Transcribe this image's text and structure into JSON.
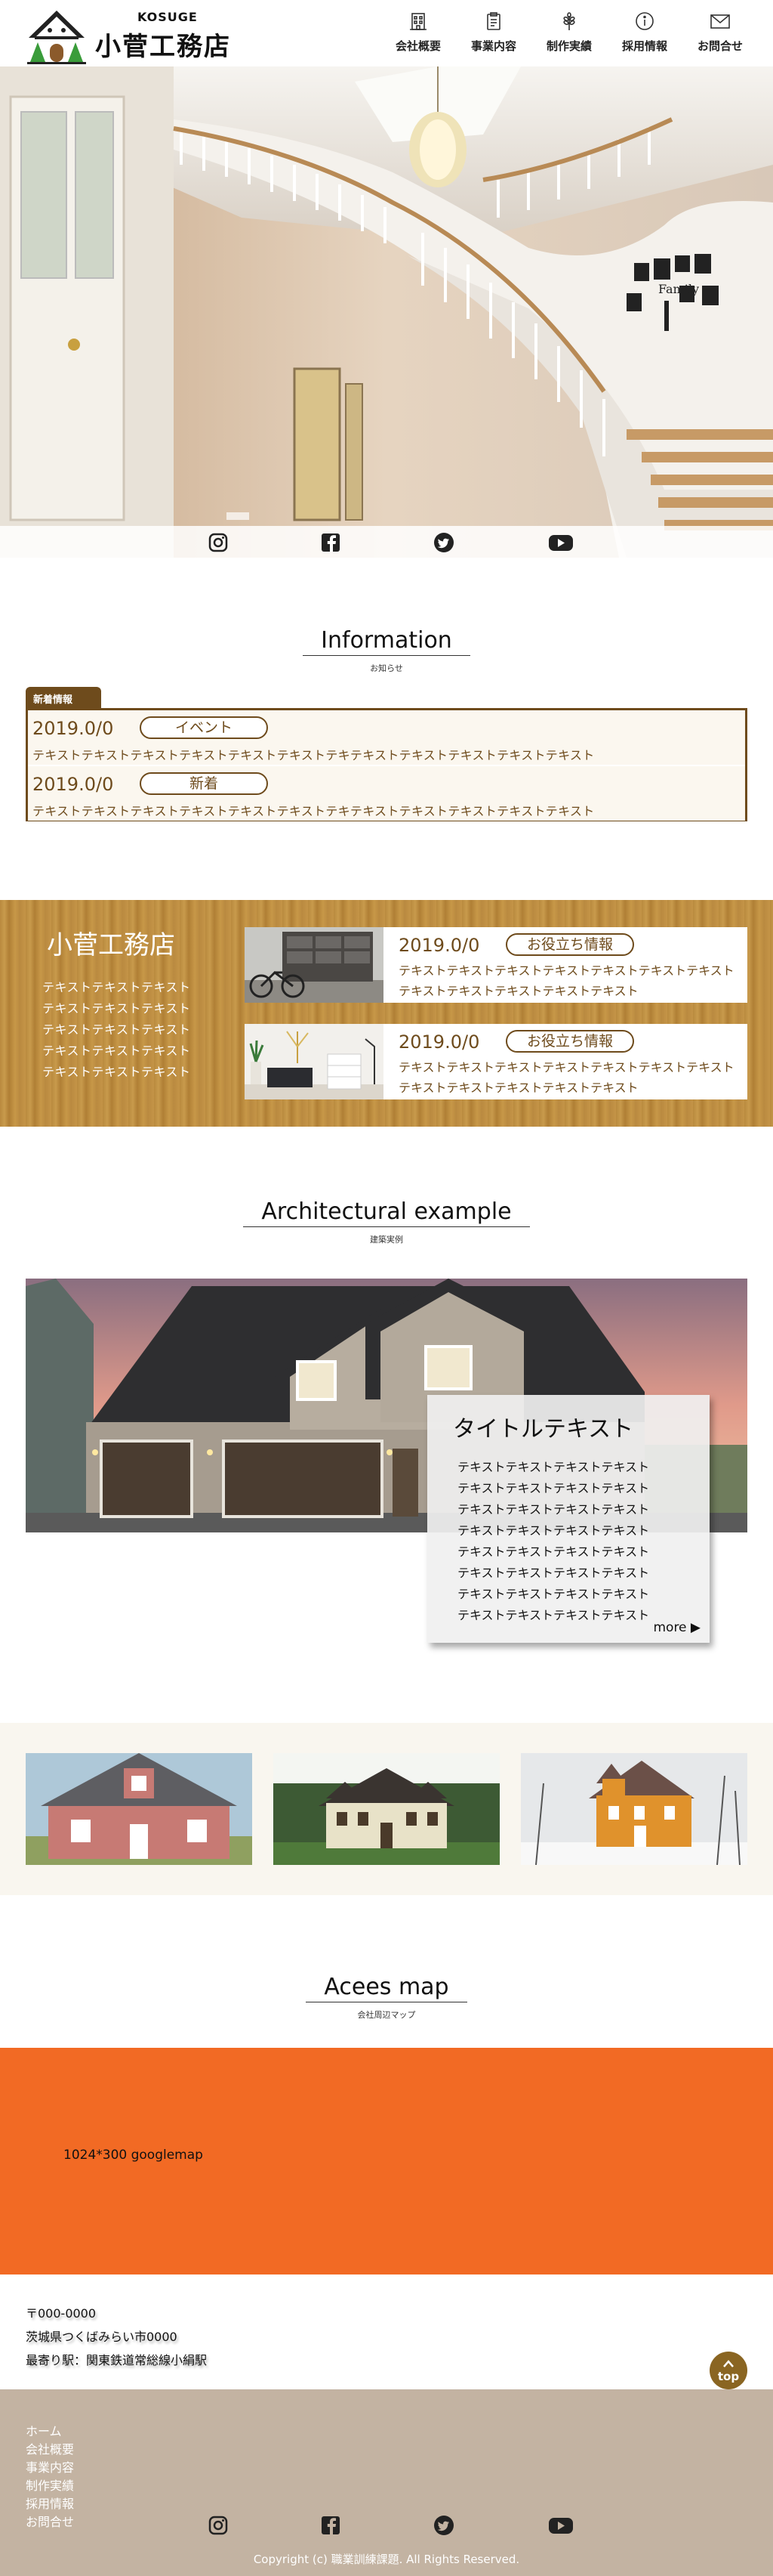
{
  "header": {
    "logo_kosuge": "KOSUGE",
    "logo_name": "小菅工務店",
    "nav": [
      {
        "label": "会社概要",
        "icon": "building-icon"
      },
      {
        "label": "事業内容",
        "icon": "clipboard-icon"
      },
      {
        "label": "制作実績",
        "icon": "wheat-icon"
      },
      {
        "label": "採用情報",
        "icon": "info-icon"
      },
      {
        "label": "お問合せ",
        "icon": "mail-icon"
      }
    ]
  },
  "hero": {
    "social": [
      "instagram-icon",
      "facebook-icon",
      "twitter-icon",
      "youtube-icon"
    ]
  },
  "information": {
    "title": "Information",
    "subtitle": "お知らせ",
    "tab": "新着情報",
    "items": [
      {
        "date": "2019.0/0",
        "badge": "イベント",
        "text": "テキストテキストテキストテキストテキストテキストテキテキストテキストテキストテキストテキスト"
      },
      {
        "date": "2019.0/0",
        "badge": "新着",
        "text": "テキストテキストテキストテキストテキストテキストテキテキストテキストテキストテキストテキスト"
      }
    ]
  },
  "company": {
    "title": "小菅工務店",
    "lines": [
      "テキストテキストテキスト",
      "テキストテキストテキスト",
      "テキストテキストテキスト",
      "テキストテキストテキスト",
      "テキストテキストテキスト"
    ],
    "posts": [
      {
        "date": "2019.0/0",
        "badge": "お役立ち情報",
        "text": "テキストテキストテキストテキストテキストテキストテキストテキストテキストテキストテキストテキスト"
      },
      {
        "date": "2019.0/0",
        "badge": "お役立ち情報",
        "text": "テキストテキストテキストテキストテキストテキストテキストテキストテキストテキストテキストテキスト"
      }
    ]
  },
  "architecture": {
    "title": "Architectural example",
    "subtitle": "建築実例",
    "card_title": "タイトルテキスト",
    "card_lines": [
      "テキストテキストテキストテキスト",
      "テキストテキストテキストテキスト",
      "テキストテキストテキストテキスト",
      "テキストテキストテキストテキスト",
      "テキストテキストテキストテキスト",
      "テキストテキストテキストテキスト",
      "テキストテキストテキストテキスト",
      "テキストテキストテキストテキスト"
    ],
    "more": "more ▶"
  },
  "map": {
    "title": "Acees map",
    "subtitle": "会社周辺マップ",
    "placeholder": "1024*300 googlemap"
  },
  "address": {
    "zip": "〒000-0000",
    "address": "茨城県つくばみらい市0000",
    "station": "最寄り駅：関東鉄道常総線小絹駅"
  },
  "top_button": "top",
  "footer": {
    "links": [
      "ホーム",
      "会社概要",
      "事業内容",
      "制作実績",
      "採用情報",
      "お問合せ"
    ],
    "copyright": "Copyright (c) 職業訓練課題. All Rights Reserved."
  },
  "colors": {
    "brand_brown": "#6e4b1c",
    "map_orange": "#f26a24",
    "footer_bg": "#c3b3a2",
    "gallery_bg": "#f9f6ef"
  }
}
